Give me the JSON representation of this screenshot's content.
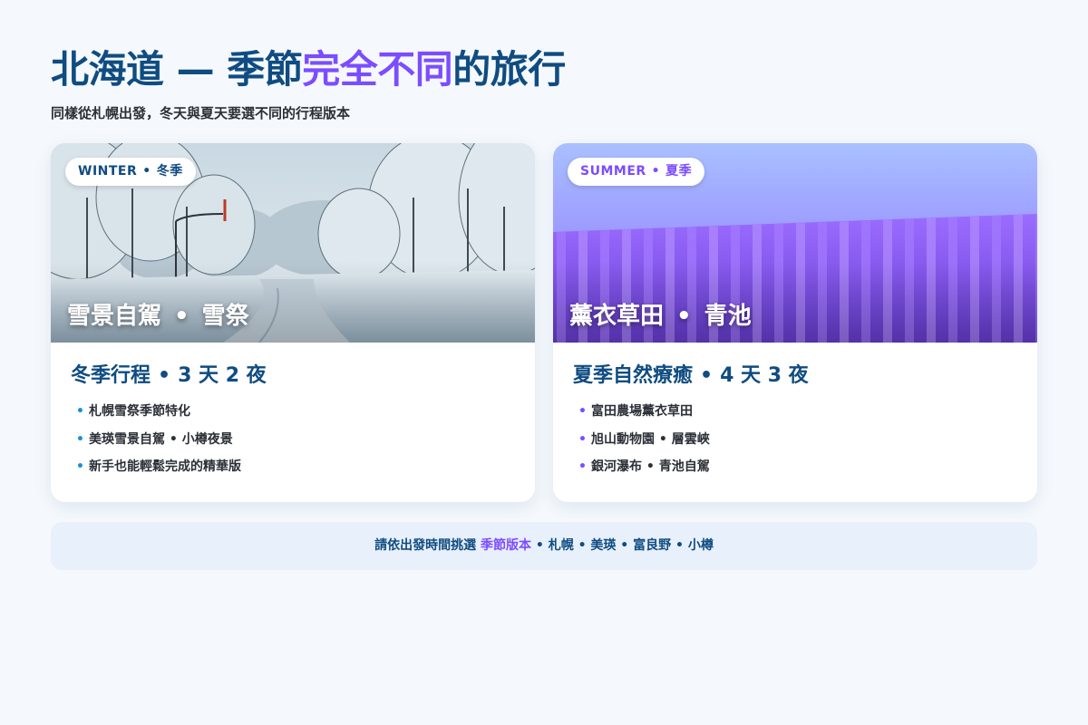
{
  "header": {
    "title_part1": "北海道 — 季節",
    "title_accent": "完全不同",
    "title_part2": "的旅行",
    "subtitle": "同樣從札幌出發，冬天與夏天要選不同的行程版本"
  },
  "cards": [
    {
      "season_en": "WINTER",
      "separator": "•",
      "season_zh": "冬季",
      "hero_title_a": "雪景自駕",
      "hero_title_b": "雪祭",
      "heading_a": "冬季行程",
      "heading_b": "3 天 2 夜",
      "bullets": [
        "札幌雪祭季節特化",
        "美瑛雪景自駕 • 小樽夜景",
        "新手也能輕鬆完成的精華版"
      ]
    },
    {
      "season_en": "SUMMER",
      "separator": "•",
      "season_zh": "夏季",
      "hero_title_a": "薰衣草田",
      "hero_title_b": "青池",
      "heading_a": "夏季自然療癒",
      "heading_b": "4 天 3 夜",
      "bullets": [
        "富田農場薰衣草田",
        "旭山動物園 • 層雲峽",
        "銀河瀑布 • 青池自駕"
      ]
    }
  ],
  "footer": {
    "prefix": "請依出發時間挑選 ",
    "highlight": "季節版本",
    "suffix": " • 札幌 • 美瑛 • 富良野 • 小樽"
  },
  "colors": {
    "primary": "#0f4c81",
    "accent": "#7c4dff",
    "background": "#f5f9fd",
    "winter_bullet": "#1a8fd8",
    "summer_bullet": "#7c4dff"
  },
  "icons": {
    "bullet": "bullet-dot-icon"
  }
}
